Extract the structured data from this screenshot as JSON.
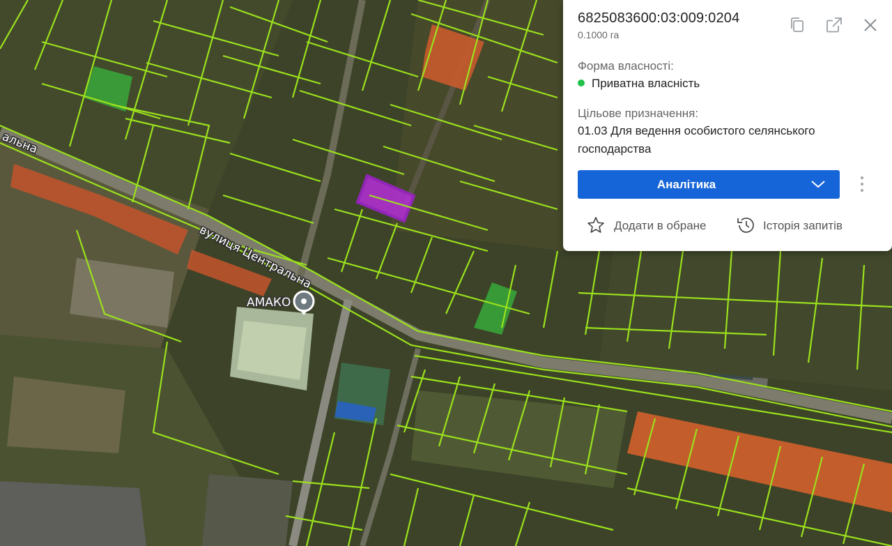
{
  "map": {
    "street_label_main": "вулиця Центральна",
    "street_label_left": "альна",
    "poi_label": "АМАКО"
  },
  "panel": {
    "cadastral_number": "6825083600:03:009:0204",
    "area": "0.1000 га",
    "ownership_label": "Форма власності:",
    "ownership_value": "Приватна власність",
    "ownership_color": "#22c24a",
    "purpose_label": "Цільове призначення:",
    "purpose_value": "01.03 Для ведення особистого селянського господарства",
    "analytics_button": "Аналітика",
    "favorite_action": "Додати в обране",
    "history_action": "Історія запитів",
    "accent_color": "#1565d8",
    "icons": [
      "copy-icon",
      "open-external-icon",
      "close-icon",
      "chevron-down-icon",
      "more-vertical-icon",
      "star-icon",
      "history-icon"
    ]
  }
}
